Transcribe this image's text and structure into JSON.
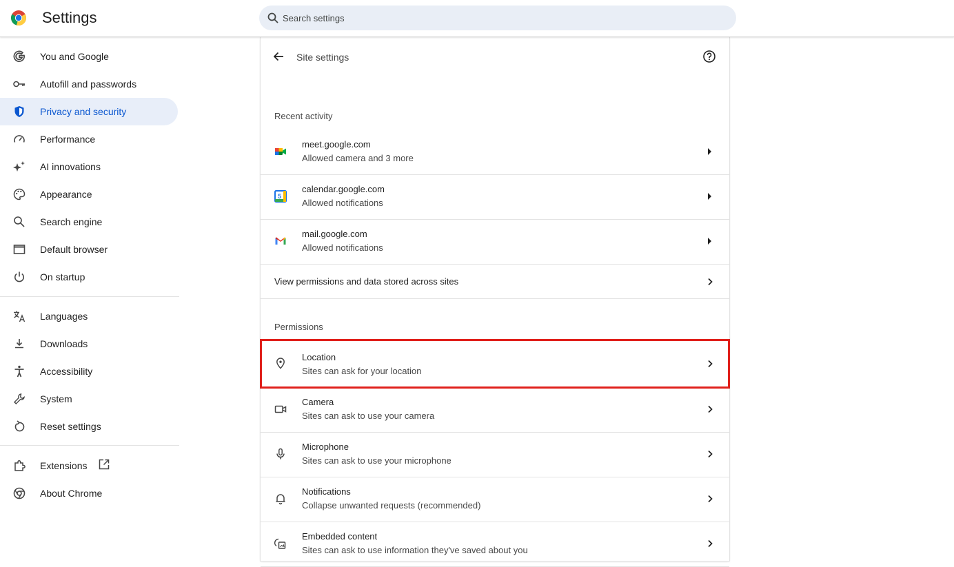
{
  "app": {
    "title": "Settings",
    "logo": "chrome-logo-icon"
  },
  "search": {
    "placeholder": "Search settings"
  },
  "colors": {
    "accent": "#0b57d0",
    "active_bg": "#e8eef9",
    "highlight": "#e0201b"
  },
  "sidebar": {
    "items": [
      {
        "label": "You and Google",
        "icon": "google-g-icon"
      },
      {
        "label": "Autofill and passwords",
        "icon": "key-icon"
      },
      {
        "label": "Privacy and security",
        "icon": "shield-icon",
        "active": true
      },
      {
        "label": "Performance",
        "icon": "speedometer-icon"
      },
      {
        "label": "AI innovations",
        "icon": "sparkle-icon"
      },
      {
        "label": "Appearance",
        "icon": "palette-icon"
      },
      {
        "label": "Search engine",
        "icon": "search-icon"
      },
      {
        "label": "Default browser",
        "icon": "browser-window-icon"
      },
      {
        "label": "On startup",
        "icon": "power-icon"
      },
      {
        "label": "Languages",
        "icon": "translate-icon"
      },
      {
        "label": "Downloads",
        "icon": "download-icon"
      },
      {
        "label": "Accessibility",
        "icon": "accessibility-icon"
      },
      {
        "label": "System",
        "icon": "wrench-icon"
      },
      {
        "label": "Reset settings",
        "icon": "reset-icon"
      },
      {
        "label": "Extensions",
        "icon": "puzzle-icon"
      },
      {
        "label": "About Chrome",
        "icon": "chrome-icon"
      }
    ]
  },
  "main": {
    "title": "Site settings",
    "recent_activity": {
      "heading": "Recent activity",
      "items": [
        {
          "site": "meet.google.com",
          "detail": "Allowed camera and 3 more",
          "icon": "google-meet-icon"
        },
        {
          "site": "calendar.google.com",
          "detail": "Allowed notifications",
          "icon": "google-calendar-icon"
        },
        {
          "site": "mail.google.com",
          "detail": "Allowed notifications",
          "icon": "gmail-icon"
        }
      ],
      "view_all": "View permissions and data stored across sites"
    },
    "permissions": {
      "heading": "Permissions",
      "items": [
        {
          "label": "Location",
          "detail": "Sites can ask for your location",
          "icon": "location-pin-icon",
          "highlighted": true
        },
        {
          "label": "Camera",
          "detail": "Sites can ask to use your camera",
          "icon": "camera-icon"
        },
        {
          "label": "Microphone",
          "detail": "Sites can ask to use your microphone",
          "icon": "microphone-icon"
        },
        {
          "label": "Notifications",
          "detail": "Collapse unwanted requests (recommended)",
          "icon": "bell-icon"
        },
        {
          "label": "Embedded content",
          "detail": "Sites can ask to use information they've saved about you",
          "icon": "embedded-content-icon"
        }
      ]
    }
  },
  "calendar_icon_digit": "5"
}
